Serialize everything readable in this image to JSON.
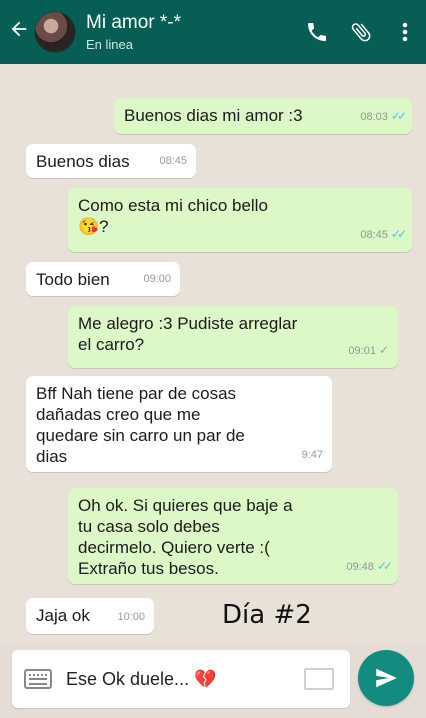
{
  "header": {
    "contact_name": "Mi amor *-*",
    "status": "En linea"
  },
  "messages": [
    {
      "dir": "out",
      "text": "Buenos dias mi amor :3",
      "time": "08:03",
      "ticks": "✓✓",
      "tick_color": "blue"
    },
    {
      "dir": "in",
      "text": "Buenos dias",
      "time": "08:45"
    },
    {
      "dir": "out",
      "text": "Como esta mi chico bello",
      "text2": "😘?",
      "time": "08:45",
      "ticks": "✓✓",
      "tick_color": "blue"
    },
    {
      "dir": "in",
      "text": "Todo bien",
      "time": "09:00"
    },
    {
      "dir": "out",
      "text": "Me alegro :3 Pudiste arreglar",
      "text2": "el carro?",
      "time": "09:01",
      "ticks": "✓",
      "tick_color": "grey"
    },
    {
      "dir": "in",
      "text": "Bff Nah tiene par de cosas",
      "text2": "dañadas creo que me",
      "text3": "quedare sin carro un par de",
      "text4": "dias",
      "time": "9:47"
    },
    {
      "dir": "out",
      "text": "Oh ok. Si quieres que baje a",
      "text2": "tu casa solo debes",
      "text3": "decirmelo. Quiero verte :(",
      "text4": "Extraño tus besos.",
      "time": "09:48",
      "ticks": "✓✓",
      "tick_color": "blue"
    },
    {
      "dir": "in",
      "text": "Jaja ok",
      "time": "10:00"
    }
  ],
  "overlay_caption": "Día #2",
  "composer": {
    "text": "Ese Ok duele... 💔"
  },
  "icons": {
    "back": "arrow-back-icon",
    "call": "phone-icon",
    "attach": "paperclip-icon",
    "menu": "more-vert-icon",
    "keyboard": "keyboard-icon",
    "camera": "camera-icon",
    "send": "send-icon"
  },
  "colors": {
    "header": "#075e54",
    "outgoing": "#dcf8c6",
    "incoming": "#ffffff",
    "send_button": "#128c7e",
    "read_tick": "#4fc3f7"
  }
}
